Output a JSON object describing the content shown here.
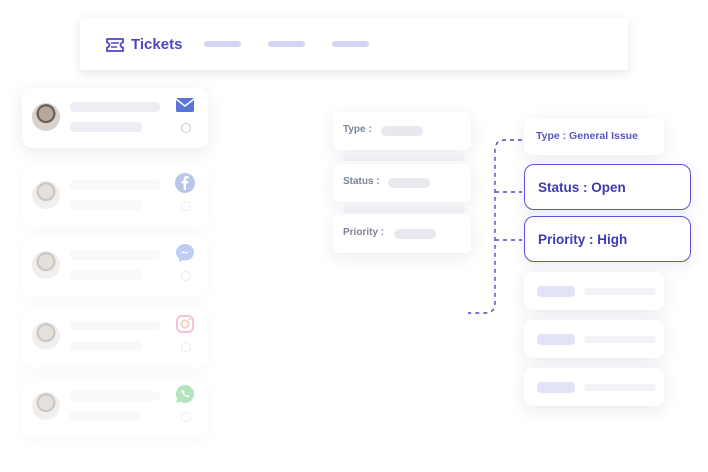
{
  "header": {
    "title": "Tickets",
    "icon": "ticket-icon",
    "accent": "#4f46c7"
  },
  "conversations": [
    {
      "channel": "email-icon",
      "avatar": "avatar-1",
      "active": true
    },
    {
      "channel": "facebook-icon",
      "avatar": "avatar-2",
      "active": false
    },
    {
      "channel": "messenger-icon",
      "avatar": "avatar-3",
      "active": false
    },
    {
      "channel": "instagram-icon",
      "avatar": "avatar-4",
      "active": false
    },
    {
      "channel": "whatsapp-icon",
      "avatar": "avatar-5",
      "active": false
    }
  ],
  "form": {
    "type_label": "Type :",
    "status_label": "Status :",
    "priority_label": "Priority :"
  },
  "details": {
    "type": "Type : General Issue",
    "status": "Status : Open",
    "priority": "Priority : High"
  }
}
